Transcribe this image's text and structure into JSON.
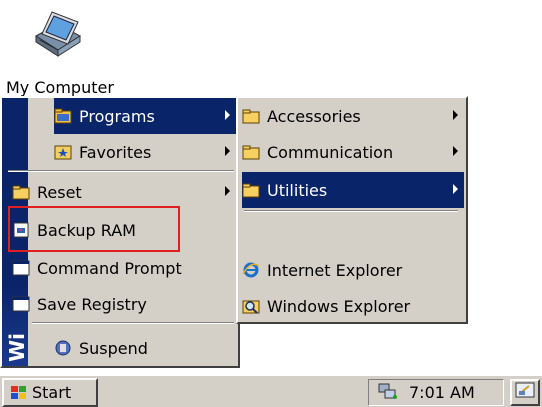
{
  "desktop": {
    "my_computer_label": "My Computer"
  },
  "start_menu": {
    "brand_text": "Wi",
    "items": [
      {
        "label": "Programs",
        "icon": "programs-folder-icon",
        "has_submenu": true,
        "selected": true
      },
      {
        "label": "Favorites",
        "icon": "favorites-icon",
        "has_submenu": true,
        "selected": false
      },
      {
        "label": "Reset",
        "icon": "folder-icon",
        "has_submenu": true,
        "selected": false
      },
      {
        "label": "Backup RAM",
        "icon": "document-icon",
        "has_submenu": false,
        "selected": false
      },
      {
        "label": "Command Prompt",
        "icon": "window-icon",
        "has_submenu": false,
        "selected": false
      },
      {
        "label": "Save Registry",
        "icon": "window-icon",
        "has_submenu": false,
        "selected": false
      },
      {
        "label": "Suspend",
        "icon": "suspend-icon",
        "has_submenu": false,
        "selected": false
      }
    ]
  },
  "programs_submenu": {
    "items": [
      {
        "label": "Accessories",
        "icon": "folder-icon",
        "has_submenu": true,
        "selected": false
      },
      {
        "label": "Communication",
        "icon": "folder-icon",
        "has_submenu": true,
        "selected": false
      },
      {
        "label": "Utilities",
        "icon": "folder-icon",
        "has_submenu": true,
        "selected": true
      },
      {
        "label": "Internet Explorer",
        "icon": "ie-icon",
        "has_submenu": false,
        "selected": false
      },
      {
        "label": "Windows Explorer",
        "icon": "explorer-icon",
        "has_submenu": false,
        "selected": false
      }
    ]
  },
  "taskbar": {
    "start_label": "Start",
    "clock": "7:01 AM"
  },
  "colors": {
    "selection": "#0a246a",
    "face": "#d4d0c8",
    "highlight_box": "#e02020"
  }
}
